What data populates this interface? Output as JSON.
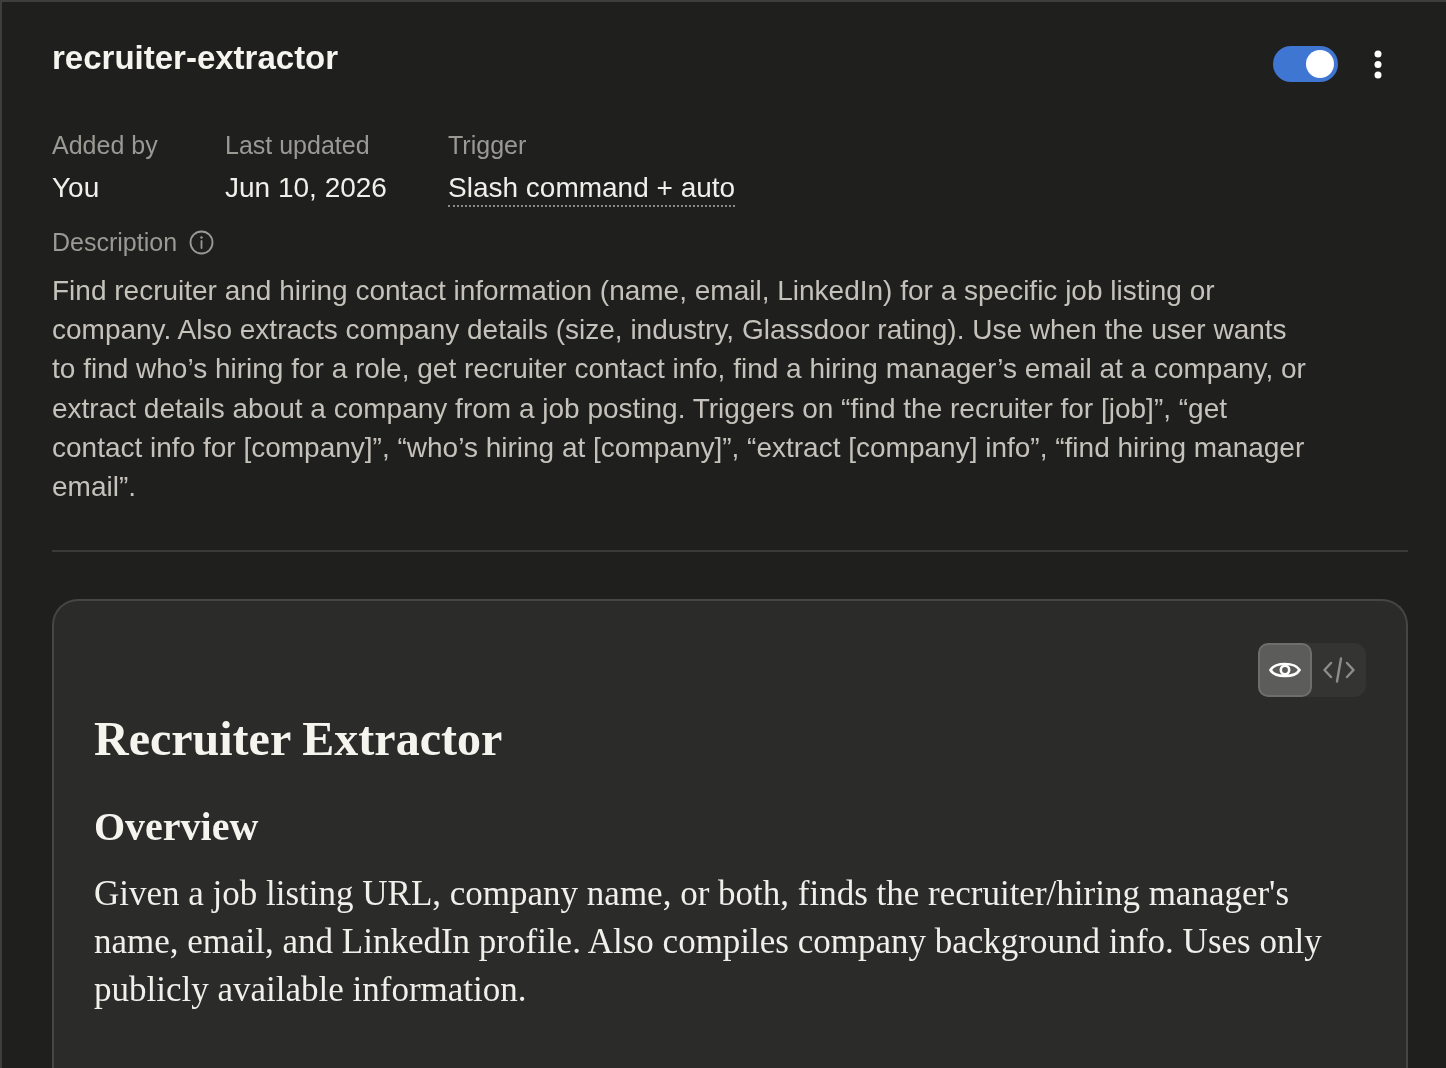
{
  "skill": {
    "name": "recruiter-extractor",
    "enabled": true
  },
  "meta": [
    {
      "label": "Added by",
      "value": "You",
      "kind": "plain"
    },
    {
      "label": "Last updated",
      "value": "Jun 10, 2026",
      "kind": "plain"
    },
    {
      "label": "Trigger",
      "value": "Slash command + auto",
      "kind": "dotted"
    }
  ],
  "description": {
    "label": "Description",
    "text": "Find recruiter and hiring contact information (name, email, LinkedIn) for a specific job listing or company. Also extracts company details (size, industry, Glassdoor rating). Use when the user wants to find who’s hiring for a role, get recruiter contact info, find a hiring manager’s email at a company, or extract details about a company from a job posting. Triggers on “find the recruiter for [job]”, “get contact info for [company]”, “who’s hiring at [company]”, “extract [company] info”, “find hiring manager email”."
  },
  "preview": {
    "view_modes": [
      {
        "kind": "preview",
        "selected": true
      },
      {
        "kind": "code",
        "selected": false
      }
    ],
    "title": "Recruiter Extractor",
    "sections": [
      {
        "heading": "Overview",
        "body": "Given a job listing URL, company name, or both, finds the recruiter/hiring manager's name, email, and LinkedIn profile. Also compiles company background info. Uses only publicly available information."
      }
    ]
  }
}
